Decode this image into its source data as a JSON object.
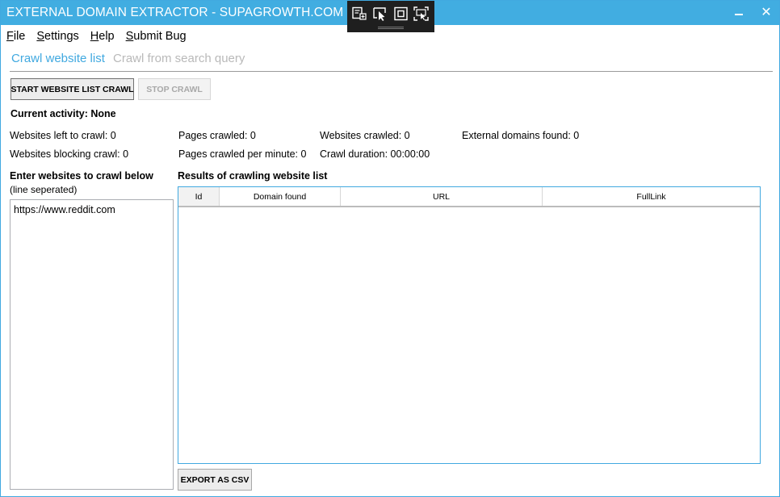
{
  "window": {
    "title": "EXTERNAL DOMAIN EXTRACTOR - SUPAGROWTH.COM",
    "minimize_icon": "minimize-icon",
    "close_icon": "close-icon",
    "close_glyph": "✕"
  },
  "devtools": {
    "icons": [
      "select-element-icon",
      "pointer-icon",
      "layout-bounds-icon",
      "track-focus-icon"
    ]
  },
  "menu": {
    "items": [
      {
        "label": "File",
        "mnemonic": "F",
        "rest": "ile"
      },
      {
        "label": "Settings",
        "mnemonic": "S",
        "rest": "ettings"
      },
      {
        "label": "Help",
        "mnemonic": "H",
        "rest": "elp"
      },
      {
        "label": "Submit Bug",
        "mnemonic": "S",
        "rest": "ubmit Bug"
      }
    ]
  },
  "tabs": {
    "active": "Crawl website list",
    "inactive": "Crawl from search query"
  },
  "buttons": {
    "start": "START WEBSITE LIST CRAWL",
    "stop": "STOP CRAWL",
    "export": "EXPORT AS CSV"
  },
  "activity": "Current activity: None",
  "stats": {
    "websites_left": "Websites left to crawl: 0",
    "websites_blocking": "Websites blocking crawl: 0",
    "pages_crawled": "Pages crawled: 0",
    "pages_per_minute": "Pages crawled per minute: 0",
    "websites_crawled": "Websites crawled: 0",
    "crawl_duration": "Crawl duration: 00:00:00",
    "external_domains": "External domains found: 0"
  },
  "input": {
    "label": "Enter websites to crawl below",
    "sublabel": "(line seperated)",
    "value": "https://www.reddit.com"
  },
  "results": {
    "label": "Results of crawling website list",
    "columns": [
      "Id",
      "Domain found",
      "URL",
      "FullLink"
    ],
    "rows": []
  },
  "colors": {
    "accent": "#41ade1",
    "inactive_tab": "#b9b9b9"
  }
}
